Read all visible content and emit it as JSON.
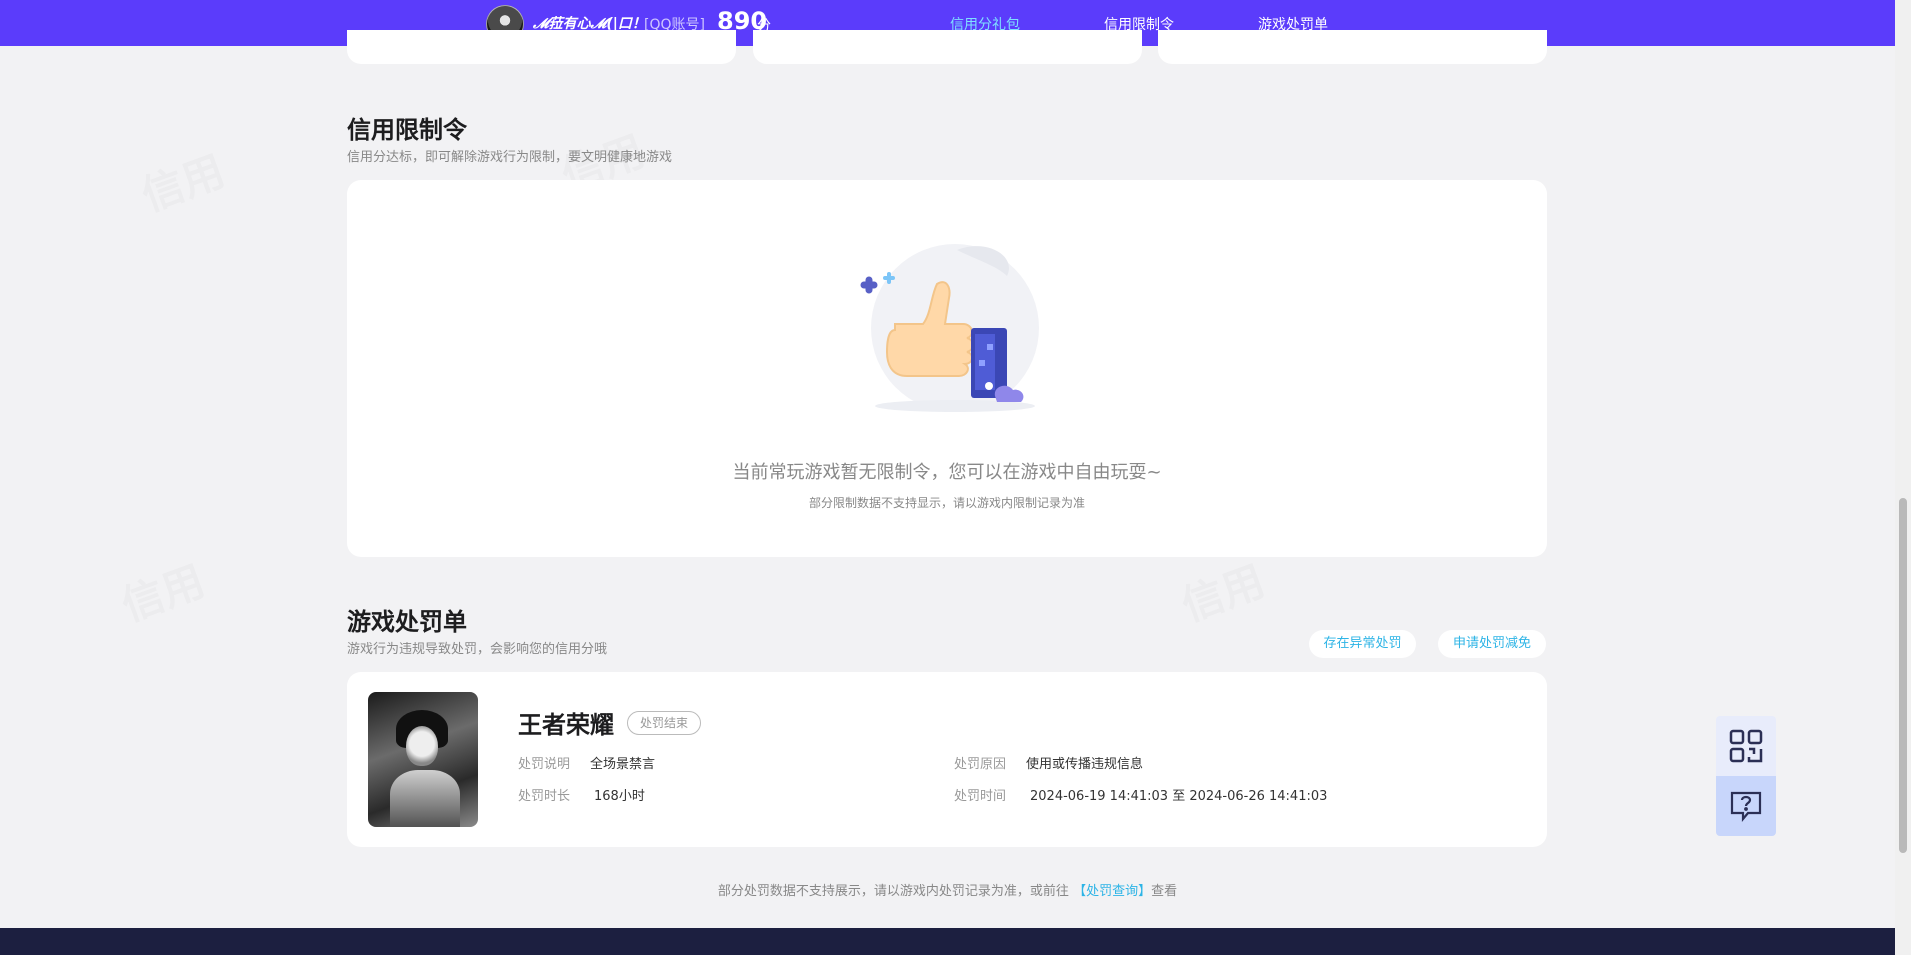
{
  "header": {
    "nickname": "𝓜菈有心𝓜(|口！",
    "account_type": "[QQ账号]",
    "score": "890",
    "score_unit": "分",
    "nav": [
      {
        "label": "信用分礼包",
        "active": true
      },
      {
        "label": "信用限制令",
        "active": false
      },
      {
        "label": "游戏处罚单",
        "active": false
      }
    ]
  },
  "restriction": {
    "title": "信用限制令",
    "subtitle": "信用分达标，即可解除游戏行为限制，要文明健康地游戏",
    "empty_text": "当前常玩游戏暂无限制令，您可以在游戏中自由玩耍~",
    "empty_subtext": "部分限制数据不支持显示，请以游戏内限制记录为准"
  },
  "penalty": {
    "title": "游戏处罚单",
    "subtitle": "游戏行为违规导致处罚，会影响您的信用分哦",
    "buttons": {
      "abnormal": "存在异常处罚",
      "reduce": "申请处罚减免"
    },
    "record": {
      "game": "王者荣耀",
      "status": "处罚结束",
      "desc_label": "处罚说明",
      "desc_value": "全场景禁言",
      "reason_label": "处罚原因",
      "reason_value": "使用或传播违规信息",
      "duration_label": "处罚时长",
      "duration_value": "168小时",
      "time_label": "处罚时间",
      "time_value": "2024-06-19 14:41:03 至 2024-06-26 14:41:03"
    },
    "footer": {
      "prefix": "部分处罚数据不支持展示，请以游戏内处罚记录为准，或前往",
      "link": "【处罚查询】",
      "suffix": "查看"
    }
  },
  "icons": {
    "qr": "qr-code-icon",
    "help": "help-chat-icon"
  }
}
